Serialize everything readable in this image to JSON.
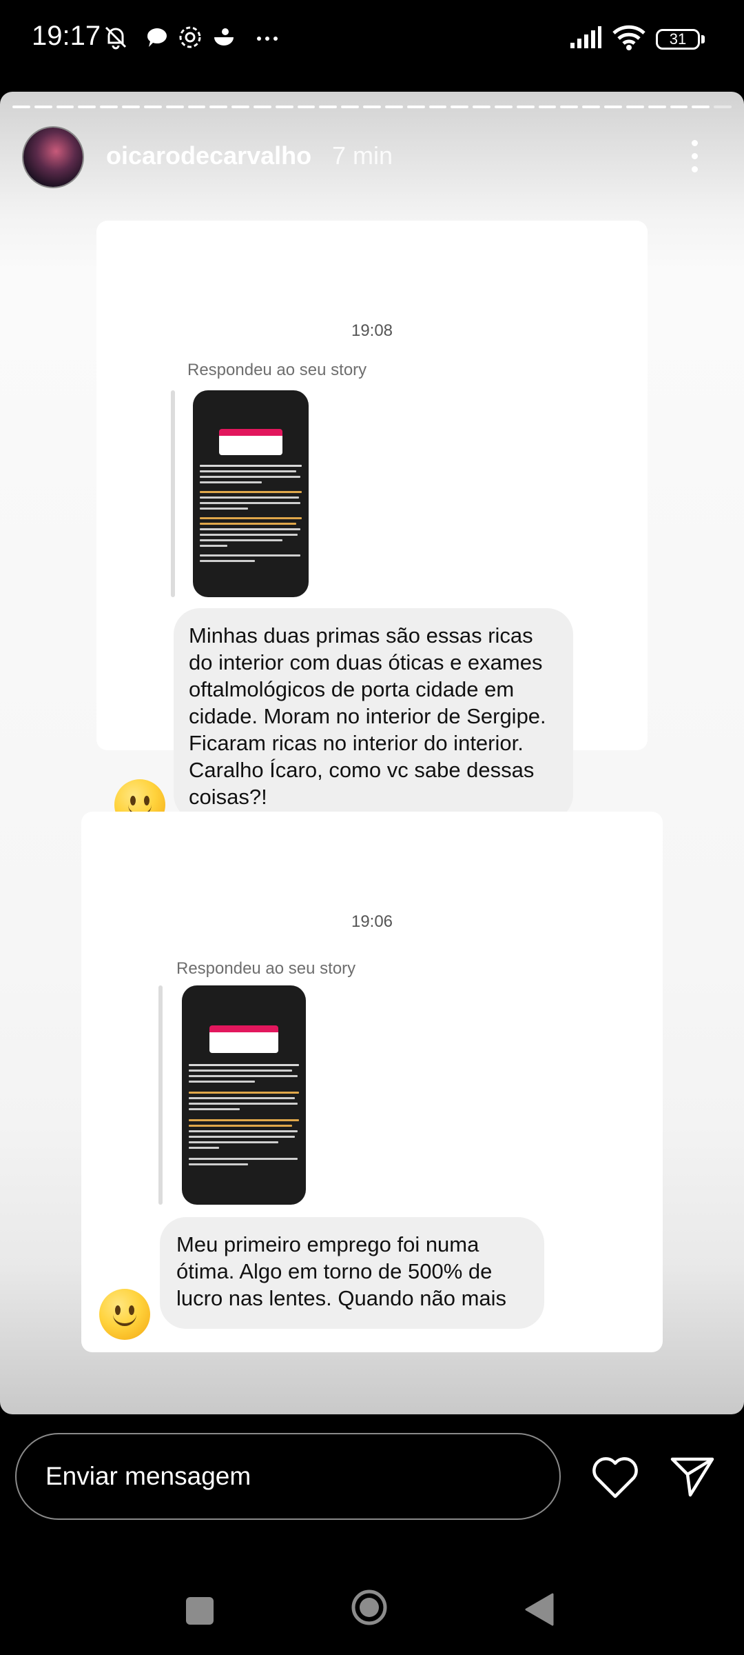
{
  "status_bar": {
    "time": "19:17",
    "battery": "31",
    "left_icons": [
      "mute-vibrate-icon",
      "chat-bubble-icon",
      "flower-icon",
      "bowl-icon",
      "more-dots-icon"
    ],
    "right_icons": [
      "signal-icon",
      "wifi-icon",
      "battery-icon"
    ]
  },
  "story": {
    "username": "oicarodecarvalho",
    "time_ago": "7 min",
    "segments_total": 33,
    "segments_viewed": 32
  },
  "messages": [
    {
      "timestamp": "19:08",
      "replied_label": "Respondeu ao seu story",
      "text": "Minhas duas primas são essas ricas do interior com duas óticas e exames oftalmológicos de porta cidade em cidade. Moram no interior de Sergipe. Ficaram ricas no interior do interior. Caralho Ícaro, como vc sabe dessas coisas?!",
      "reaction": "slightly-smiling-face-icon"
    },
    {
      "timestamp": "19:06",
      "replied_label": "Respondeu ao seu story",
      "text": "Meu primeiro emprego foi numa ótima. Algo em torno de 500% de lucro nas lentes. Quando não mais",
      "reaction": "slightly-smiling-face-icon"
    }
  ],
  "composer": {
    "placeholder": "Enviar mensagem"
  },
  "colors": {
    "accent_pink": "#e2175d",
    "bubble": "#efefef",
    "background": "#000000"
  }
}
